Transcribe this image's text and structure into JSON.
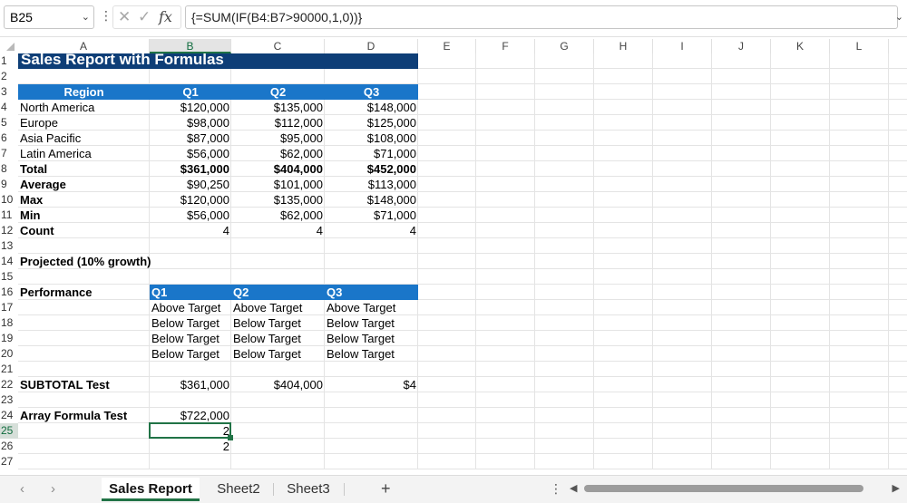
{
  "formula_bar": {
    "name_box": "B25",
    "formula": "{=SUM(IF(B4:B7>90000,1,0))}",
    "cancel_icon": "x-icon",
    "enter_icon": "check-icon",
    "function_label": "fx"
  },
  "columns": [
    "A",
    "B",
    "C",
    "D",
    "E",
    "F",
    "G",
    "H",
    "I",
    "J",
    "K",
    "L"
  ],
  "rows": [
    "1",
    "2",
    "3",
    "4",
    "5",
    "6",
    "7",
    "8",
    "9",
    "10",
    "11",
    "12",
    "13",
    "14",
    "15",
    "16",
    "17",
    "18",
    "19",
    "20",
    "21",
    "22",
    "23",
    "24",
    "25",
    "26",
    "27"
  ],
  "cells": {
    "title": "Sales Report with Formulas",
    "table_header": [
      "Region",
      "Q1",
      "Q2",
      "Q3"
    ],
    "data_rows": [
      [
        "North America",
        "$120,000",
        "$135,000",
        "$148,000"
      ],
      [
        "Europe",
        "$98,000",
        "$112,000",
        "$125,000"
      ],
      [
        "Asia Pacific",
        "$87,000",
        "$95,000",
        "$108,000"
      ],
      [
        "Latin America",
        "$56,000",
        "$62,000",
        "$71,000"
      ]
    ],
    "summary_rows": [
      [
        "Total",
        "$361,000",
        "$404,000",
        "$452,000"
      ],
      [
        "Average",
        "$90,250",
        "$101,000",
        "$113,000"
      ],
      [
        "Max",
        "$120,000",
        "$135,000",
        "$148,000"
      ],
      [
        "Min",
        "$56,000",
        "$62,000",
        "$71,000"
      ],
      [
        "Count",
        "4",
        "4",
        "4"
      ]
    ],
    "projected_label": "Projected (10% growth)",
    "performance_label": "Performance",
    "performance_header": [
      "Q1",
      "Q2",
      "Q3"
    ],
    "performance_rows": [
      [
        "Above Target",
        "Above Target",
        "Above Target"
      ],
      [
        "Below Target",
        "Below Target",
        "Below Target"
      ],
      [
        "Below Target",
        "Below Target",
        "Below Target"
      ],
      [
        "Below Target",
        "Below Target",
        "Below Target"
      ]
    ],
    "subtotal_label": "SUBTOTAL Test",
    "subtotal_values": [
      "$361,000",
      "$404,000",
      "$4"
    ],
    "array_label": "Array Formula Test",
    "array_values": [
      "$722,000",
      "2",
      "2"
    ]
  },
  "sheet_tabs": [
    "Sales Report",
    "Sheet2",
    "Sheet3"
  ],
  "active_tab": "Sales Report",
  "colors": {
    "accent": "#217346",
    "header_blue": "#1a76c9",
    "title_blue": "#0e3e77"
  }
}
